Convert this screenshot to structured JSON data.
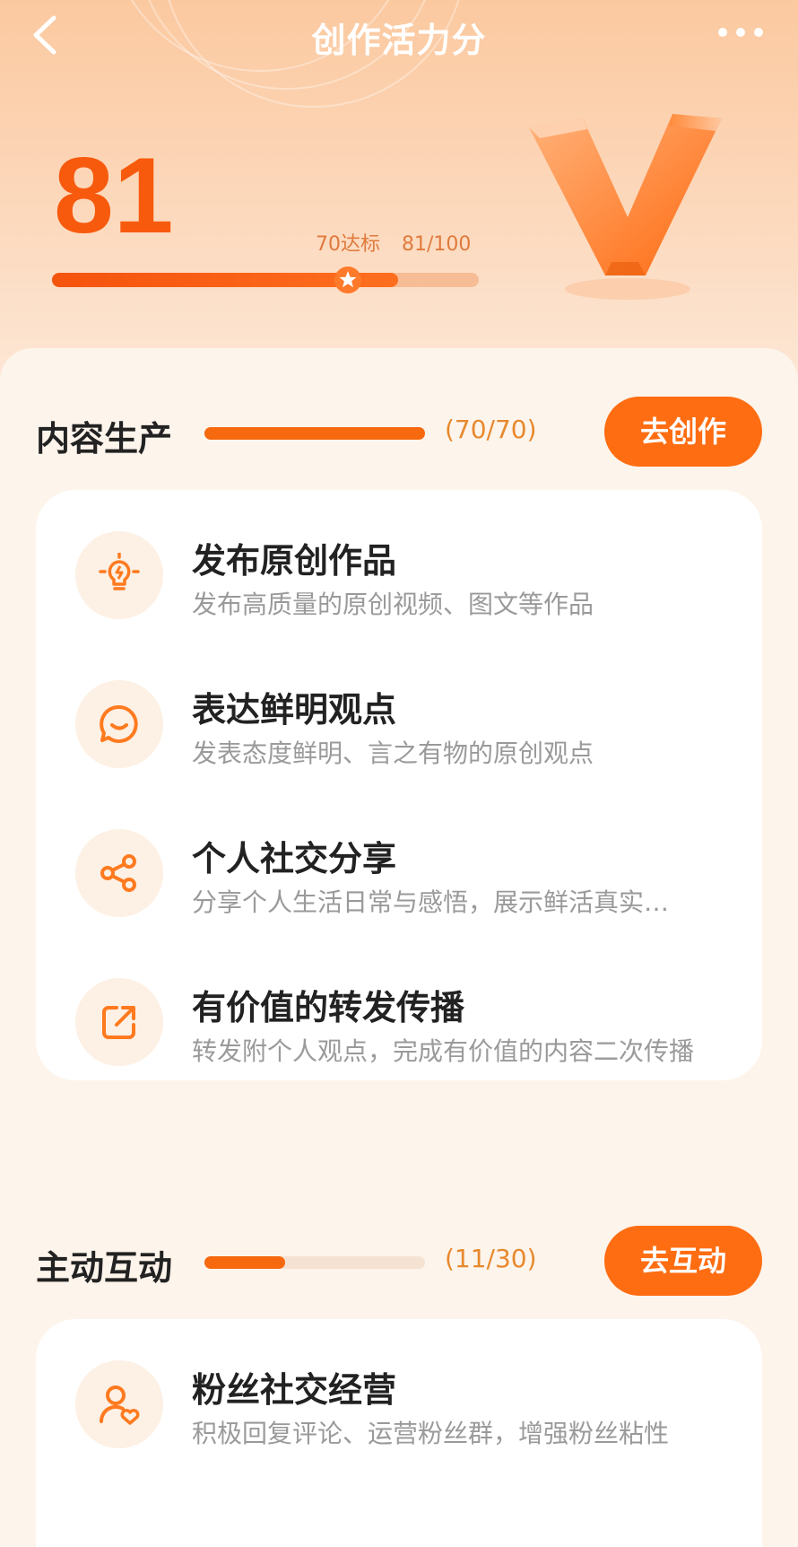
{
  "header": {
    "title": "创作活力分",
    "score": "81",
    "target_label": "70达标",
    "score_fraction": "81/100",
    "progress": 0.81
  },
  "sections": [
    {
      "title": "内容生产",
      "count": "(70/70)",
      "progress": 1.0,
      "button": "去创作",
      "items": [
        {
          "title": "发布原创作品",
          "desc": "发布高质量的原创视频、图文等作品",
          "icon": "bulb-icon"
        },
        {
          "title": "表达鲜明观点",
          "desc": "发表态度鲜明、言之有物的原创观点",
          "icon": "chat-bubble-icon"
        },
        {
          "title": "个人社交分享",
          "desc": "分享个人生活日常与感悟，展示鲜活真实…",
          "icon": "share-icon"
        },
        {
          "title": "有价值的转发传播",
          "desc": "转发附个人观点，完成有价值的内容二次传播",
          "icon": "forward-icon"
        }
      ]
    },
    {
      "title": "主动互动",
      "count": "(11/30)",
      "progress": 0.3667,
      "button": "去互动",
      "items": [
        {
          "title": "粉丝社交经营",
          "desc": "积极回复评论、运营粉丝群，增强粉丝粘性",
          "icon": "user-heart-icon"
        }
      ]
    }
  ],
  "colors": {
    "accent": "#ff6d12",
    "score": "#f75a0d",
    "count": "#e7892e"
  }
}
